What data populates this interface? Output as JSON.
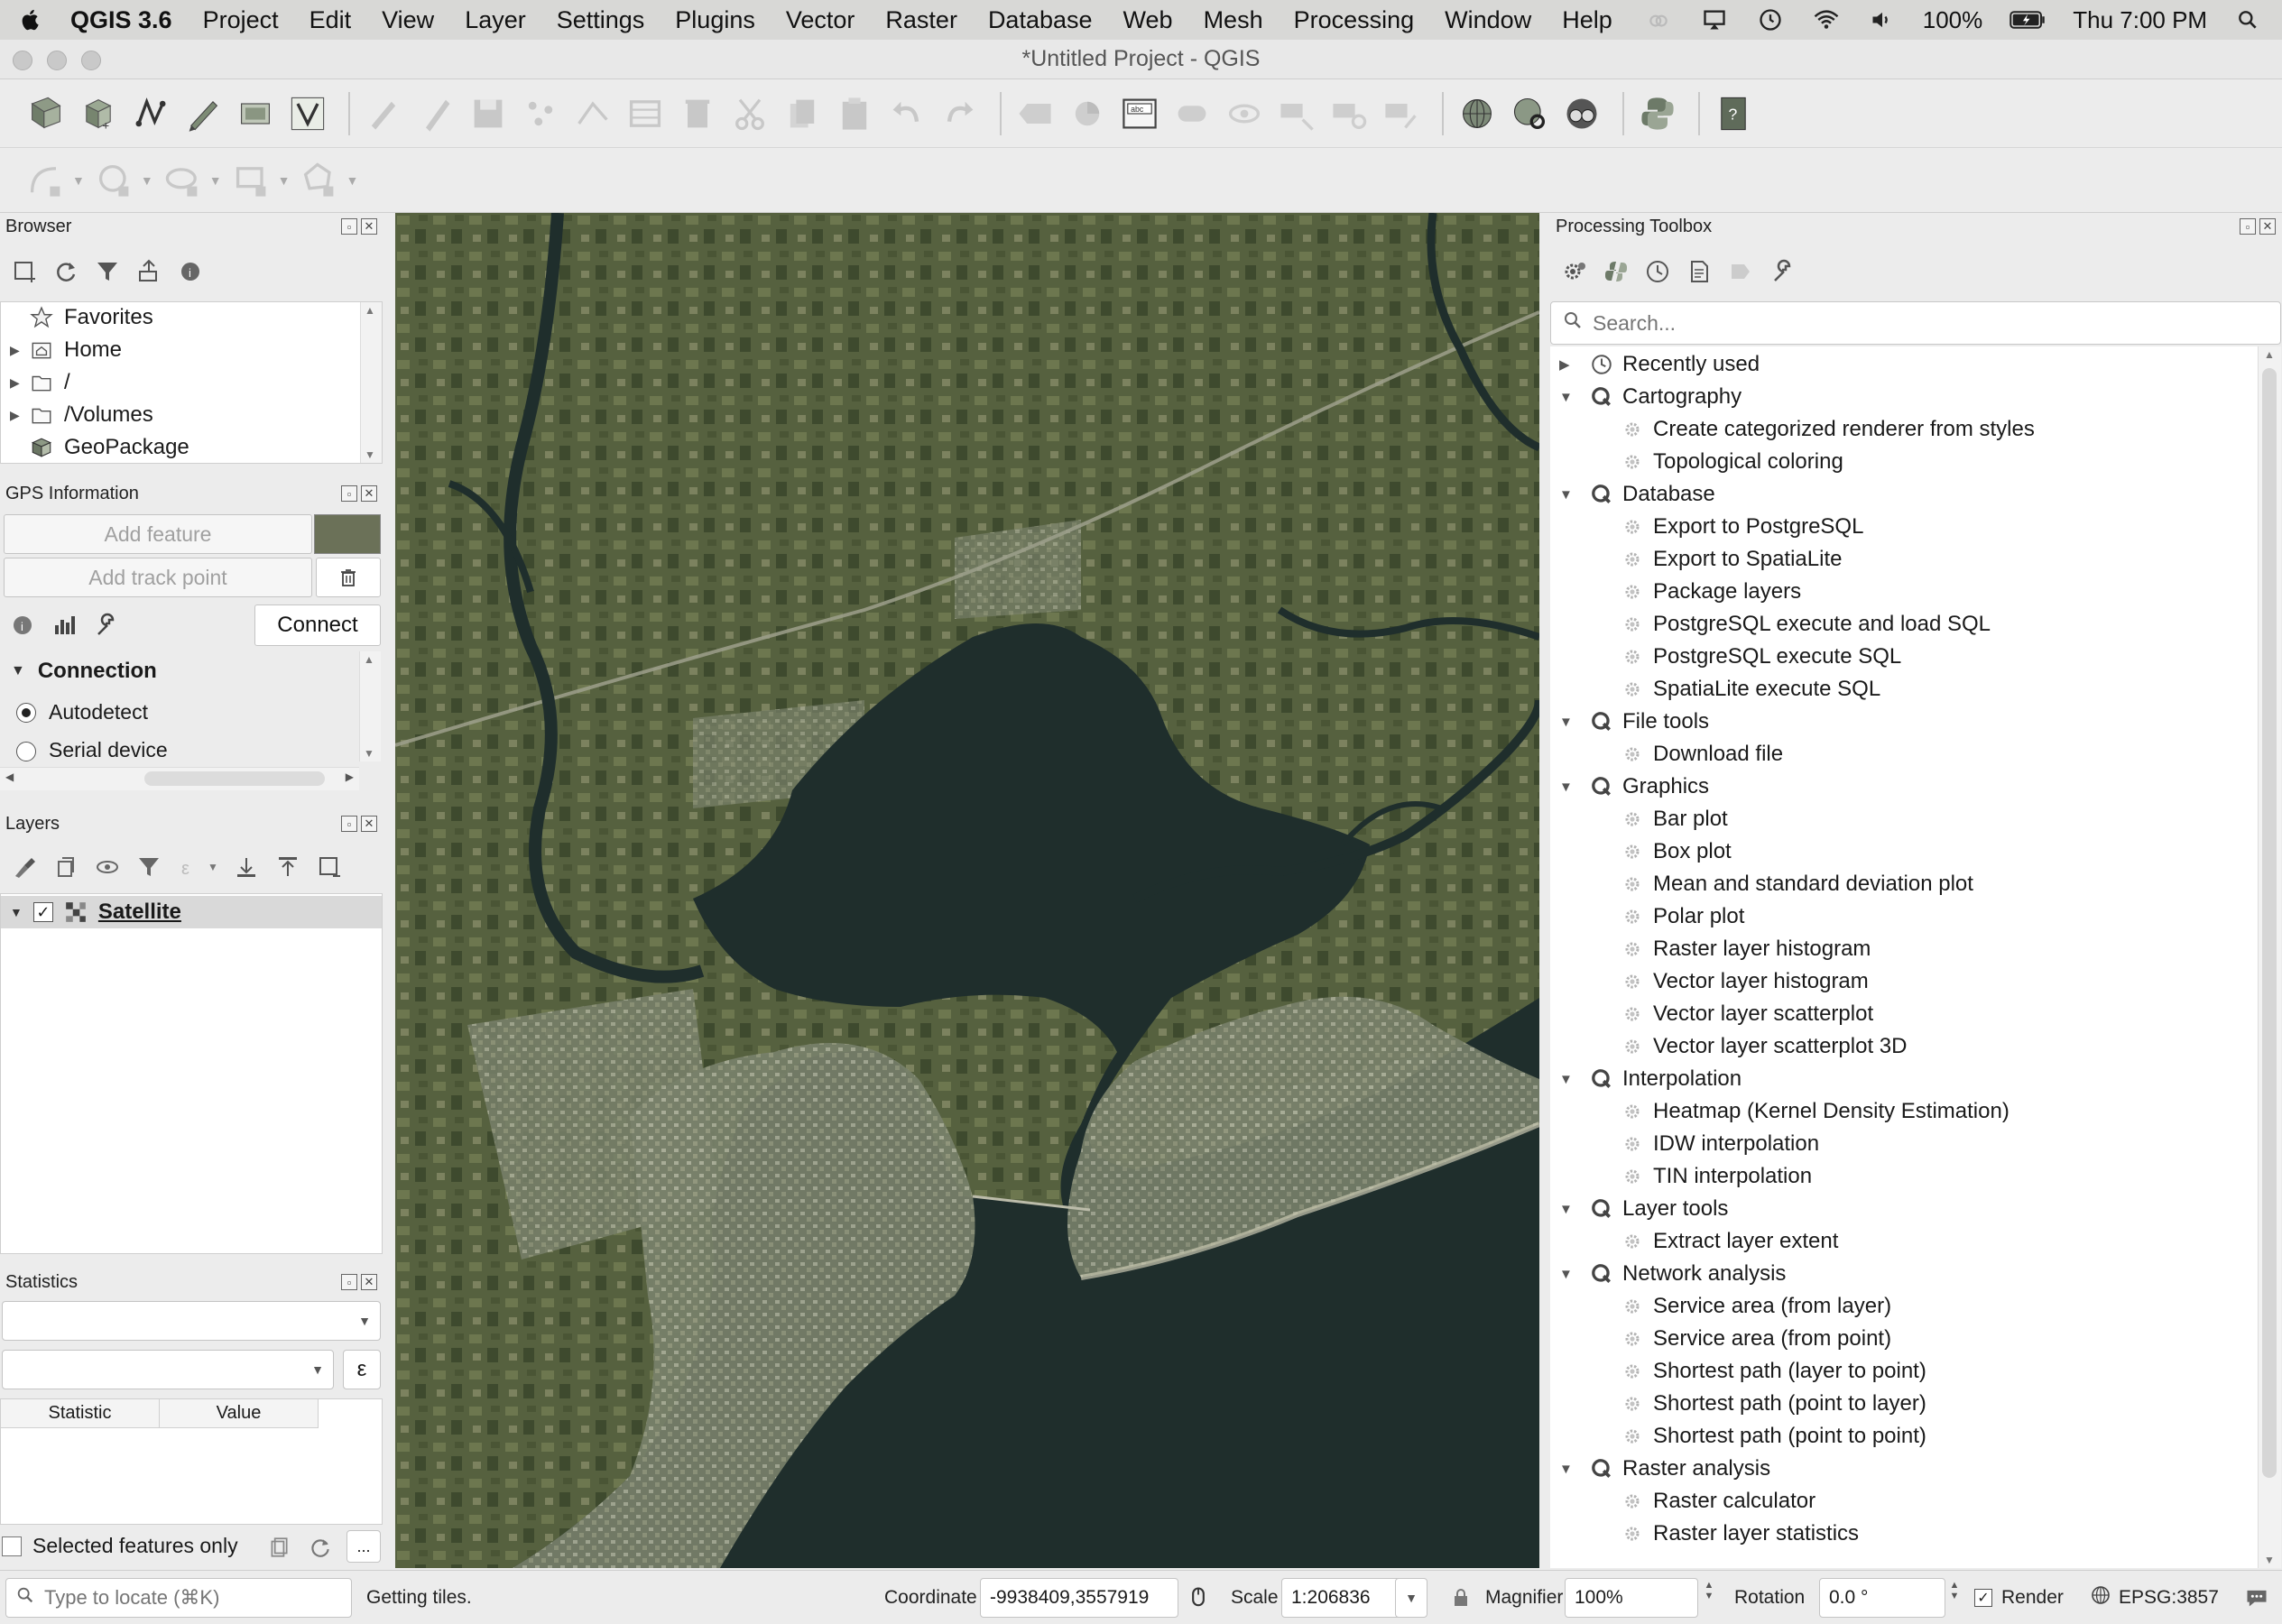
{
  "menubar": {
    "app_name": "QGIS 3.6",
    "items": [
      "Project",
      "Edit",
      "View",
      "Layer",
      "Settings",
      "Plugins",
      "Vector",
      "Raster",
      "Database",
      "Web",
      "Mesh",
      "Processing",
      "Window",
      "Help"
    ],
    "battery": "100%",
    "clock": "Thu 7:00 PM"
  },
  "window": {
    "title": "*Untitled Project - QGIS"
  },
  "browser": {
    "title": "Browser",
    "items": [
      {
        "label": "Favorites",
        "icon": "star-icon",
        "expandable": false
      },
      {
        "label": "Home",
        "icon": "home-folder-icon",
        "expandable": true
      },
      {
        "label": "/",
        "icon": "folder-icon",
        "expandable": true
      },
      {
        "label": "/Volumes",
        "icon": "folder-icon",
        "expandable": true
      },
      {
        "label": "GeoPackage",
        "icon": "geopackage-icon",
        "expandable": false
      }
    ]
  },
  "gps": {
    "title": "GPS Information",
    "add_feature": "Add feature",
    "add_track_point": "Add track point",
    "connect": "Connect",
    "connection_header": "Connection",
    "autodetect": "Autodetect",
    "serial_device": "Serial device",
    "color_swatch": "#6b7158"
  },
  "layers": {
    "title": "Layers",
    "items": [
      {
        "label": "Satellite",
        "checked": true
      }
    ]
  },
  "statistics": {
    "title": "Statistics",
    "col_statistic": "Statistic",
    "col_value": "Value",
    "selected_only": "Selected features only",
    "more_button": "..."
  },
  "toolbox": {
    "title": "Processing Toolbox",
    "search_placeholder": "Search...",
    "groups": [
      {
        "label": "Recently used",
        "expanded": false,
        "icon": "clock-icon",
        "items": []
      },
      {
        "label": "Cartography",
        "expanded": true,
        "items": [
          "Create categorized renderer from styles",
          "Topological coloring"
        ]
      },
      {
        "label": "Database",
        "expanded": true,
        "items": [
          "Export to PostgreSQL",
          "Export to SpatiaLite",
          "Package layers",
          "PostgreSQL execute and load SQL",
          "PostgreSQL execute SQL",
          "SpatiaLite execute SQL"
        ]
      },
      {
        "label": "File tools",
        "expanded": true,
        "items": [
          "Download file"
        ]
      },
      {
        "label": "Graphics",
        "expanded": true,
        "items": [
          "Bar plot",
          "Box plot",
          "Mean and standard deviation plot",
          "Polar plot",
          "Raster layer histogram",
          "Vector layer histogram",
          "Vector layer scatterplot",
          "Vector layer scatterplot 3D"
        ]
      },
      {
        "label": "Interpolation",
        "expanded": true,
        "items": [
          "Heatmap (Kernel Density Estimation)",
          "IDW interpolation",
          "TIN interpolation"
        ]
      },
      {
        "label": "Layer tools",
        "expanded": true,
        "items": [
          "Extract layer extent"
        ]
      },
      {
        "label": "Network analysis",
        "expanded": true,
        "items": [
          "Service area (from layer)",
          "Service area (from point)",
          "Shortest path (layer to point)",
          "Shortest path (point to layer)",
          "Shortest path (point to point)"
        ]
      },
      {
        "label": "Raster analysis",
        "expanded": true,
        "items": [
          "Raster calculator",
          "Raster layer statistics"
        ]
      }
    ]
  },
  "statusbar": {
    "locate_placeholder": "Type to locate (⌘K)",
    "message": "Getting tiles.",
    "coordinate_label": "Coordinate",
    "coordinate_value": "-9938409,3557919",
    "scale_label": "Scale",
    "scale_value": "1:206836",
    "magnifier_label": "Magnifier",
    "magnifier_value": "100%",
    "rotation_label": "Rotation",
    "rotation_value": "0.0 °",
    "render_label": "Render",
    "render_checked": true,
    "crs": "EPSG:3857"
  },
  "colors": {
    "map_land": "#4f5b3c",
    "map_water": "#1f2e2c",
    "panel_bg": "#ececec",
    "accent_icon": "#3f7a3f"
  }
}
